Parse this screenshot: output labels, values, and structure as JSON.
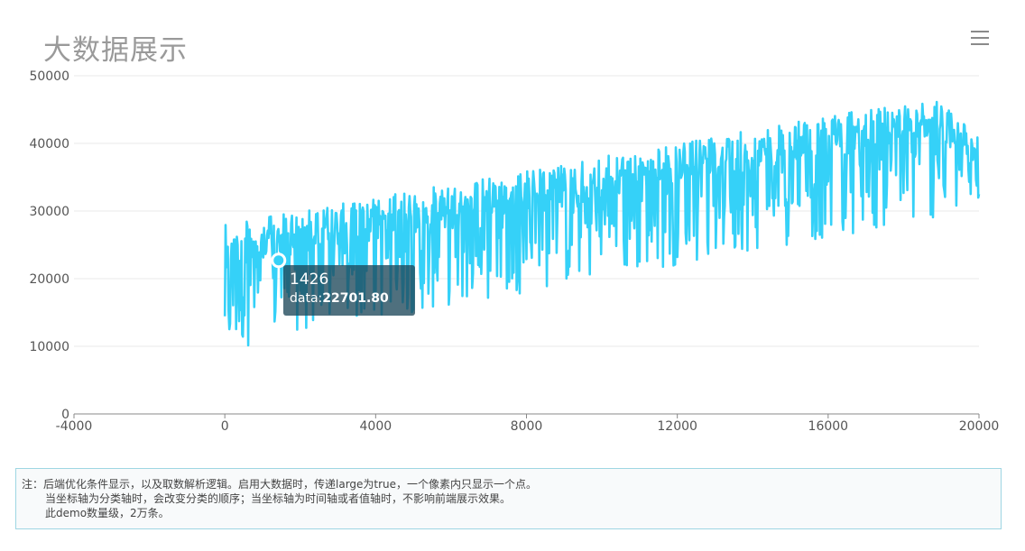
{
  "header": {
    "title": "大数据展示",
    "menu_icon": "hamburger-menu-icon"
  },
  "chart_data": {
    "type": "line",
    "title": "大数据展示",
    "xlabel": "",
    "ylabel": "",
    "x_axis_type": "value",
    "xlim": [
      -4000,
      20000
    ],
    "ylim": [
      0,
      50000
    ],
    "x_ticks": [
      "-4000",
      "0",
      "4000",
      "8000",
      "12000",
      "16000",
      "20000"
    ],
    "y_ticks": [
      "0",
      "10000",
      "20000",
      "30000",
      "40000",
      "50000"
    ],
    "series": [
      {
        "color": "#35d1f8",
        "point_count": 20000,
        "x_start": 0,
        "x_end": 20000,
        "x": [
          0,
          1000,
          2000,
          3000,
          4000,
          5000,
          6000,
          7000,
          8000,
          9000,
          10000,
          11000,
          12000,
          13000,
          14000,
          15000,
          16000,
          17000,
          18000,
          19000,
          20000
        ],
        "upper_envelope": [
          28000,
          29000,
          30000,
          31000,
          32000,
          33000,
          34000,
          35000,
          36000,
          37000,
          38000,
          39000,
          40000,
          41000,
          42000,
          43000,
          44000,
          45000,
          46000,
          47000,
          41000
        ],
        "lower_envelope": [
          8500,
          11000,
          12000,
          13000,
          14000,
          15000,
          16000,
          17000,
          18000,
          19000,
          20000,
          21000,
          22000,
          23000,
          24000,
          25000,
          26000,
          27000,
          28000,
          29000,
          30000
        ]
      }
    ],
    "tooltip": {
      "x": 1426,
      "label": "data",
      "value": "22701.80"
    },
    "grid": true,
    "legend": "none"
  },
  "note": {
    "line1": "注：后端优化条件显示，以及取数解析逻辑。启用大数据时，传递large为true，一个像素内只显示一个点。",
    "line2": "当坐标轴为分类轴时，会改变分类的顺序；当坐标轴为时间轴或者值轴时，不影响前端展示效果。",
    "line3": "此demo数量级，2万条。"
  }
}
